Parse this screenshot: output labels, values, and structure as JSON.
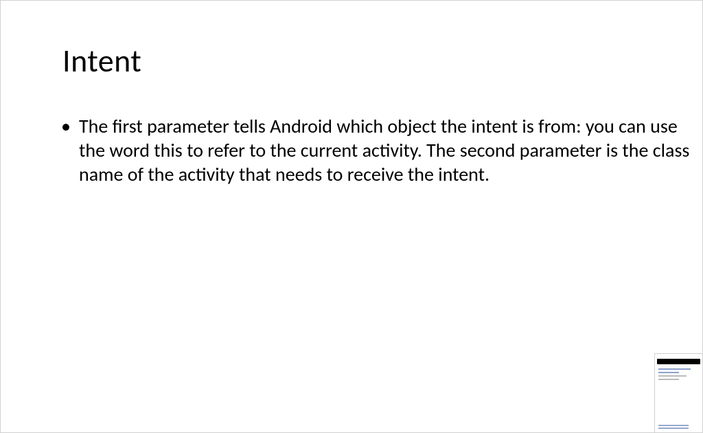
{
  "slide": {
    "title": "Intent",
    "bullets": [
      "The first parameter tells Android which object the intent is from: you can use the word this to refer to the current activity. The second parameter is the class name of the activity that needs to receive the intent."
    ]
  }
}
